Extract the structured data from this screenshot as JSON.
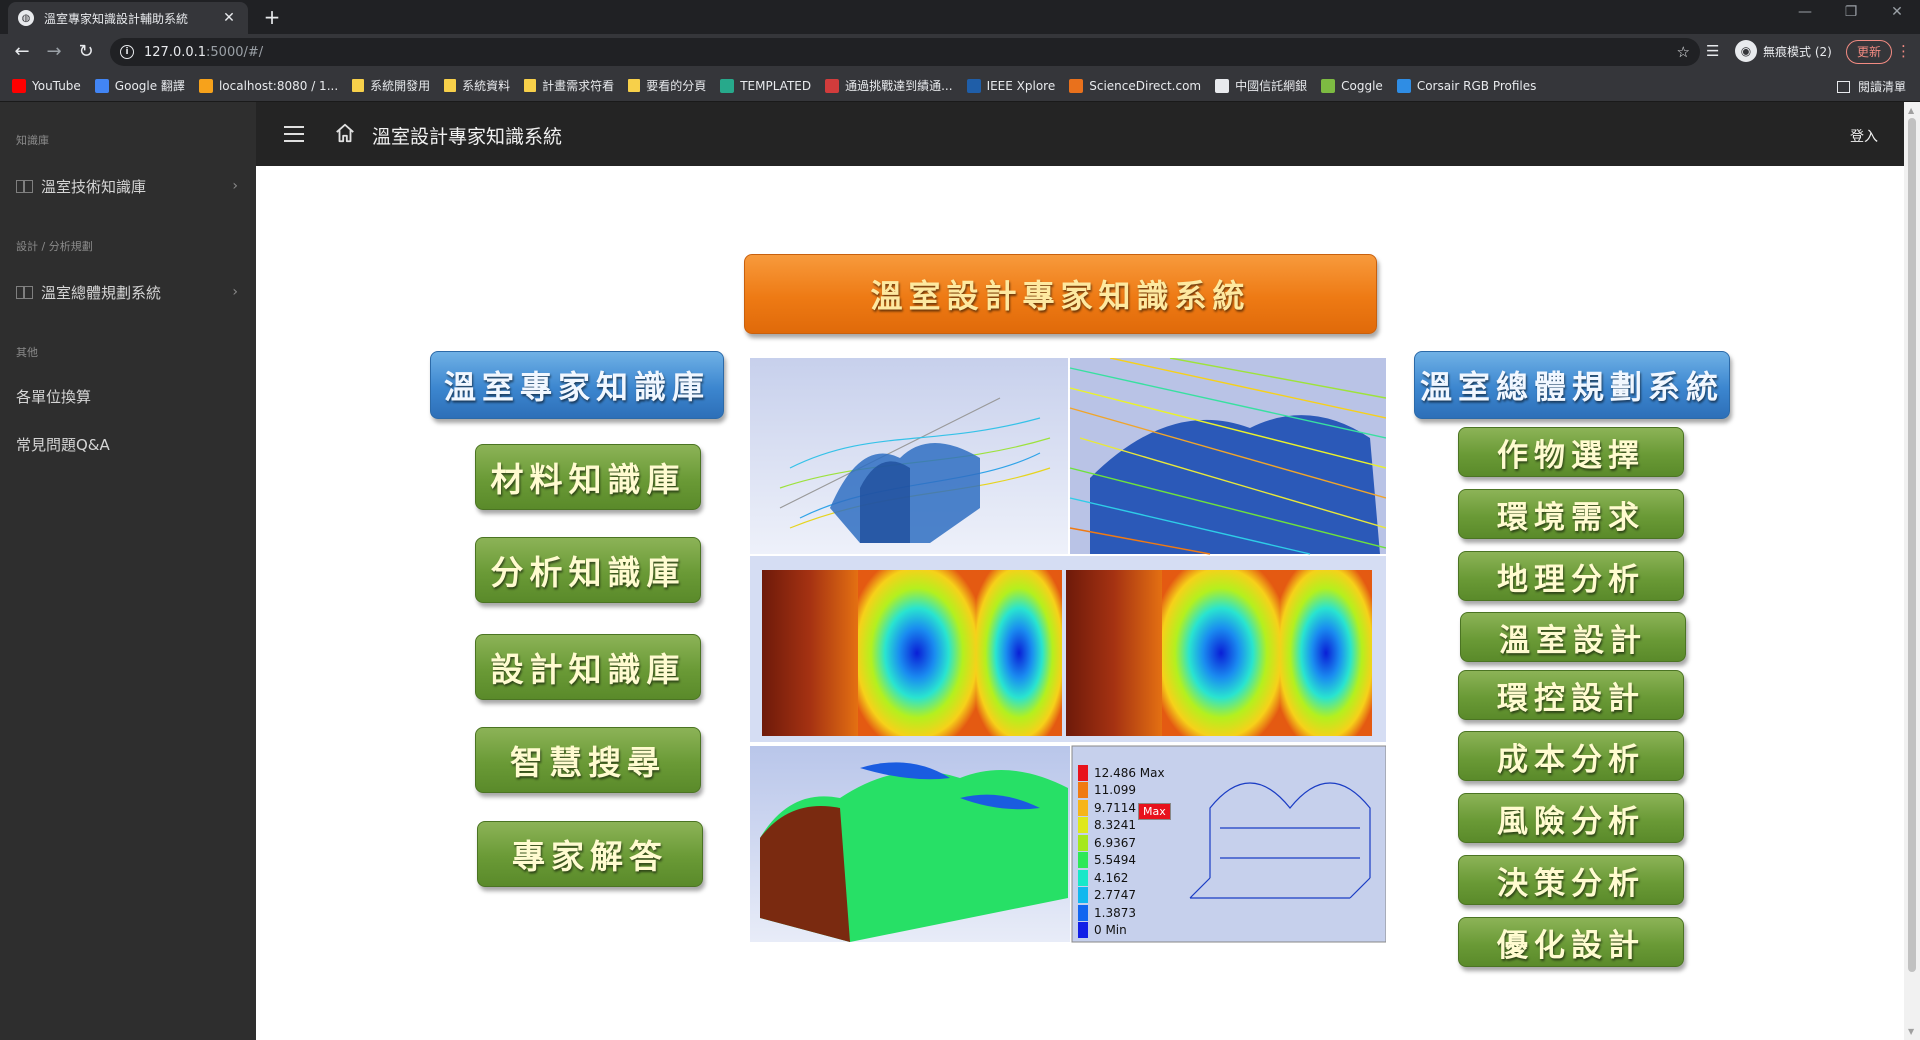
{
  "browser": {
    "tab_title": "溫室專家知識設計輔助系統",
    "url_host": "127.0.0.1",
    "url_path": ":5000/#/",
    "profile_label": "無痕模式 (2)",
    "update_label": "更新",
    "reading_list": "閱讀清單",
    "bookmarks": [
      {
        "label": "YouTube",
        "icon": "youtube-icon",
        "color": "#ff0000"
      },
      {
        "label": "Google 翻譯",
        "icon": "translate-icon",
        "color": "#4285f4"
      },
      {
        "label": "localhost:8080 / 1...",
        "icon": "phpmyadmin-icon",
        "color": "#f7a21b"
      },
      {
        "label": "系統開發用",
        "icon": "folder-icon"
      },
      {
        "label": "系統資料",
        "icon": "folder-icon"
      },
      {
        "label": "計畫需求符看",
        "icon": "folder-icon"
      },
      {
        "label": "要看的分頁",
        "icon": "folder-icon"
      },
      {
        "label": "TEMPLATED",
        "icon": "templated-icon",
        "color": "#27a98b"
      },
      {
        "label": "通過挑戰達到績通...",
        "icon": "red-site-icon",
        "color": "#d23c3c"
      },
      {
        "label": "IEEE Xplore",
        "icon": "ieee-icon",
        "color": "#1f5ea8"
      },
      {
        "label": "ScienceDirect.com",
        "icon": "elsevier-icon",
        "color": "#e9711c"
      },
      {
        "label": "中國信託網銀",
        "icon": "globe-icon",
        "color": "#e8eaed"
      },
      {
        "label": "Coggle",
        "icon": "coggle-icon",
        "color": "#7dbb42"
      },
      {
        "label": "Corsair RGB Profiles",
        "icon": "corsair-icon",
        "color": "#2f8de4"
      }
    ]
  },
  "sidebar": {
    "sections": [
      {
        "title": "知識庫",
        "items": [
          {
            "label": "溫室技術知識庫",
            "icon": "book-icon",
            "expandable": true
          }
        ]
      },
      {
        "title": "設計 / 分析規劃",
        "items": [
          {
            "label": "溫室總體規劃系統",
            "icon": "book-icon",
            "expandable": true
          }
        ]
      },
      {
        "title": "其他",
        "items": [
          {
            "label": "各單位換算"
          },
          {
            "label": "常見問題Q&A"
          }
        ]
      }
    ]
  },
  "appbar": {
    "title": "溫室設計專家知識系統",
    "login": "登入"
  },
  "diagram": {
    "main_title": "溫室設計專家知識系統",
    "left_header": "溫室專家知識庫",
    "left_items": [
      "材料知識庫",
      "分析知識庫",
      "設計知識庫",
      "智慧搜尋",
      "專家解答"
    ],
    "right_header": "溫室總體規劃系統",
    "right_items": [
      "作物選擇",
      "環境需求",
      "地理分析",
      "溫室設計",
      "環控設計",
      "成本分析",
      "風險分析",
      "決策分析",
      "優化設計"
    ],
    "legend": {
      "values": [
        "12.486 Max",
        "11.099",
        "9.7114",
        "8.3241",
        "6.9367",
        "5.5494",
        "4.162",
        "2.7747",
        "1.3873",
        "0 Min"
      ],
      "colors": [
        "#e8121c",
        "#f07a12",
        "#f6b51a",
        "#dfe81c",
        "#a6e81e",
        "#2ee858",
        "#17e8c8",
        "#12b8ee",
        "#1266f0",
        "#1220e6"
      ],
      "max_tag": "Max"
    }
  }
}
